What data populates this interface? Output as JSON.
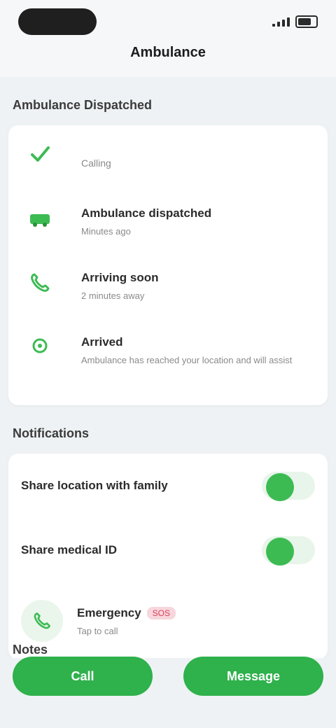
{
  "header": {
    "title": "Ambulance"
  },
  "timeline": {
    "section_title": "Ambulance Dispatched",
    "steps": [
      {
        "title": "Calling",
        "subtitle": ""
      },
      {
        "title": "Ambulance dispatched",
        "subtitle": "Minutes ago"
      },
      {
        "title": "Arriving soon",
        "subtitle": "2 minutes away"
      },
      {
        "title": "Arrived",
        "subtitle": "Ambulance has reached your location and will assist"
      }
    ]
  },
  "settings": {
    "section_title": "Notifications",
    "toggles": [
      {
        "label": "Share location with family",
        "on": true
      },
      {
        "label": "Share medical ID",
        "on": true
      }
    ],
    "contact": {
      "name": "Emergency",
      "tag": "SOS",
      "subtitle": "Tap to call"
    }
  },
  "more": {
    "section_title": "Notes"
  },
  "actions": {
    "primary": "Call",
    "secondary": "Message"
  },
  "colors": {
    "accent": "#2fb14c",
    "tag_bg": "#f7d6dc",
    "tag_text": "#d9415a"
  }
}
